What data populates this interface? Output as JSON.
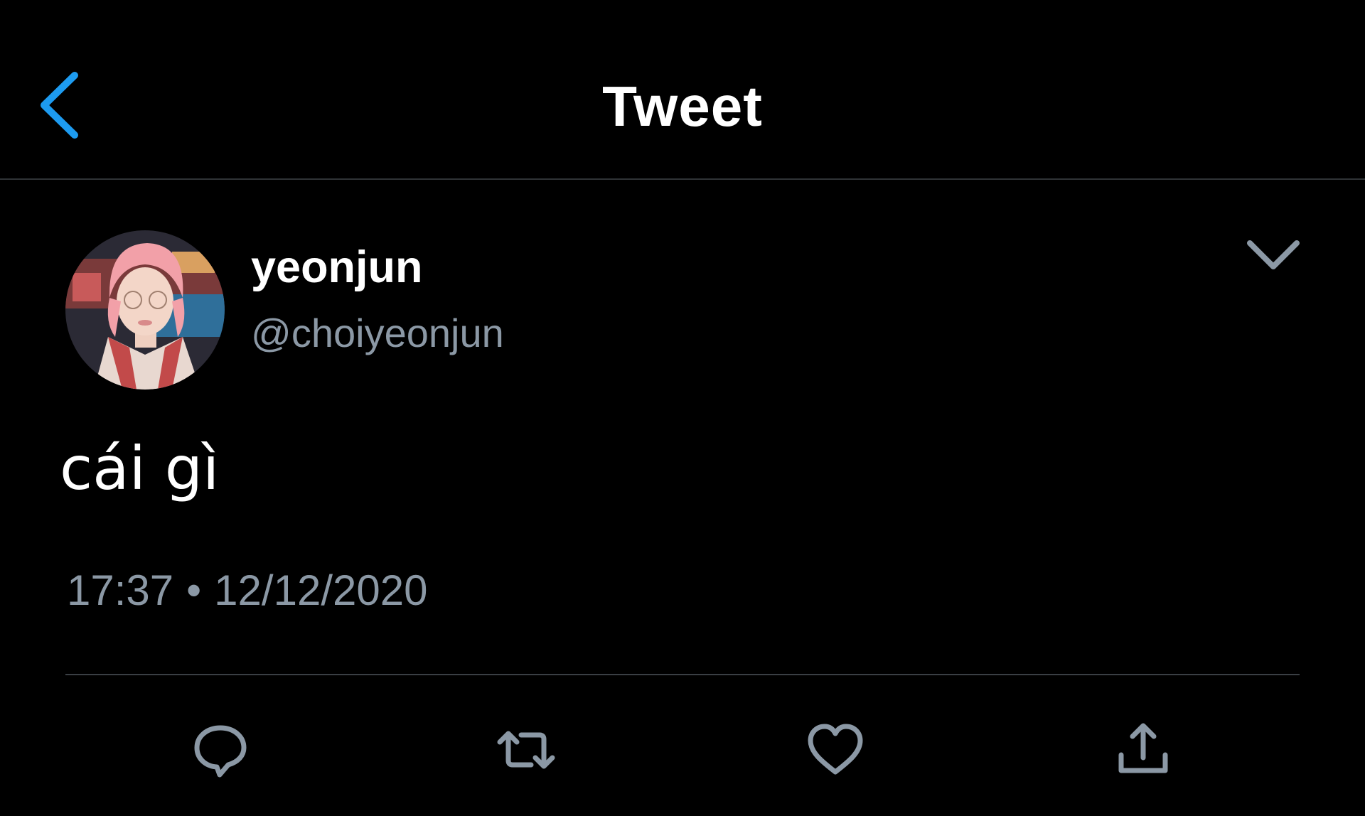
{
  "header": {
    "title": "Tweet"
  },
  "author": {
    "display_name": "yeonjun",
    "handle": "@choiyeonjun"
  },
  "tweet": {
    "text": "cái gì",
    "time": "17:37",
    "separator": "•",
    "date": "12/12/2020"
  },
  "icons": {
    "back": "chevron-left-icon",
    "more": "chevron-down-icon",
    "reply": "reply-icon",
    "retweet": "retweet-icon",
    "like": "heart-icon",
    "share": "share-icon"
  },
  "colors": {
    "background": "#000000",
    "accent": "#1d9bf0",
    "secondary_text": "#8b98a5",
    "divider": "#2f3336"
  }
}
